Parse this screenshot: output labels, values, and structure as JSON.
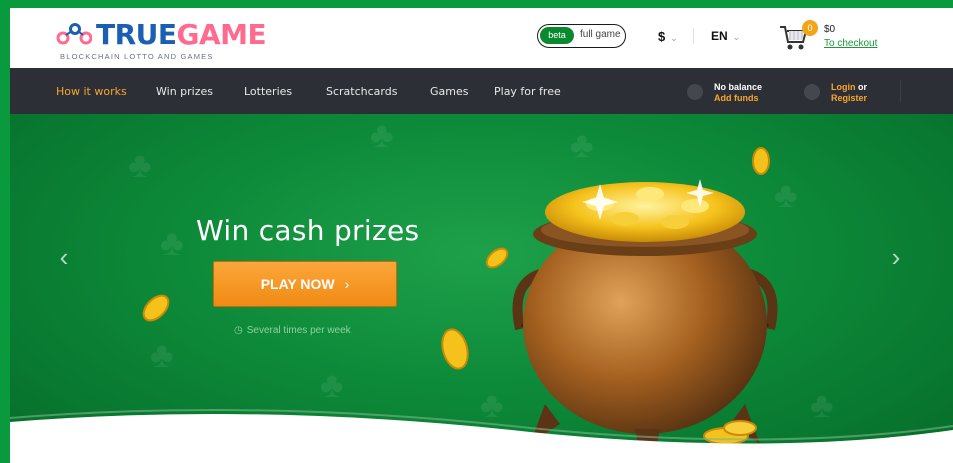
{
  "header": {
    "logo": {
      "name_part1": "TRUE",
      "name_part2": "GAME",
      "tagline": "BLOCKCHAIN LOTTO AND GAMES"
    },
    "version_toggle": {
      "beta_label": "beta",
      "full_label": "full game"
    },
    "currency": {
      "value": "$"
    },
    "language": {
      "value": "EN"
    },
    "cart": {
      "count": "0",
      "amount": "$0",
      "checkout_label": "To checkout"
    }
  },
  "nav": {
    "items": [
      {
        "label": "How it works",
        "active": true
      },
      {
        "label": "Win prizes"
      },
      {
        "label": "Lotteries"
      },
      {
        "label": "Scratchcards"
      },
      {
        "label": "Games"
      },
      {
        "label": "Play for free"
      }
    ],
    "balance": {
      "top": "No balance",
      "bottom": "Add funds"
    },
    "account": {
      "login": "Login",
      "or": "or",
      "register": "Register"
    }
  },
  "hero": {
    "title": "Win cash prizes",
    "cta_label": "PLAY NOW",
    "schedule": "Several times per week"
  },
  "colors": {
    "brand_green": "#0a9a3e",
    "accent_orange": "#f7a62b",
    "nav_bg": "#2d2f36",
    "logo_blue": "#1b5fb2",
    "logo_pink": "#ff6a8f"
  },
  "icons": [
    "logo-mark-icon",
    "chevron-down-icon",
    "cart-icon",
    "wallet-icon",
    "user-icon",
    "clock-icon",
    "arrow-left-icon",
    "arrow-right-icon"
  ]
}
